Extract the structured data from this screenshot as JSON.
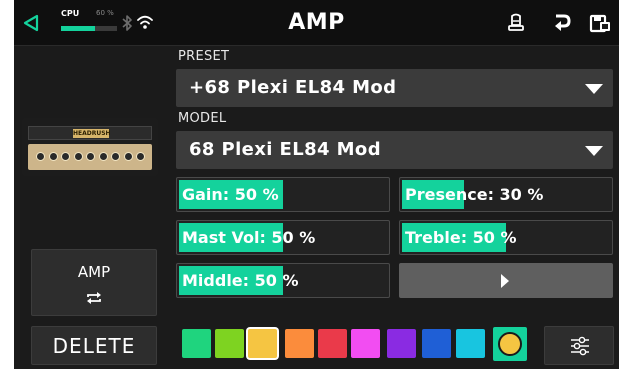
{
  "header": {
    "title": "AMP",
    "cpu_label": "CPU",
    "cpu_percent_text": "60 %",
    "cpu_usage": 0.6
  },
  "preset": {
    "label": "PRESET",
    "value": "+68 Plexi EL84 Mod"
  },
  "model": {
    "label": "MODEL",
    "value": "68 Plexi EL84 Mod"
  },
  "amp_image_badge": "HEADRUSH",
  "block_button": {
    "label": "AMP"
  },
  "delete_label": "DELETE",
  "params": [
    {
      "label": "Gain: 50 %",
      "value": 0.5
    },
    {
      "label": "Presence: 30 %",
      "value": 0.3
    },
    {
      "label": "Mast Vol: 50 %",
      "value": 0.5
    },
    {
      "label": "Treble: 50 %",
      "value": 0.5
    },
    {
      "label": "Middle: 50 %",
      "value": 0.5
    }
  ],
  "colors": {
    "accent": "#14d29c",
    "swatches": [
      "#1fd47e",
      "#7ed321",
      "#f5c542",
      "#fb8c3c",
      "#ea3a4a",
      "#f24df2",
      "#8a2be2",
      "#1f5fd6",
      "#18c5e0",
      "#f5c542"
    ],
    "selected_swatch_index": 2,
    "active_swatch_index": 9
  },
  "icons": [
    "back-arrow-icon",
    "bluetooth-icon",
    "wifi-icon",
    "tuner-icon",
    "return-arrow-icon",
    "save-icon",
    "next-arrow-icon",
    "cycle-icon",
    "settings-sliders-icon"
  ]
}
